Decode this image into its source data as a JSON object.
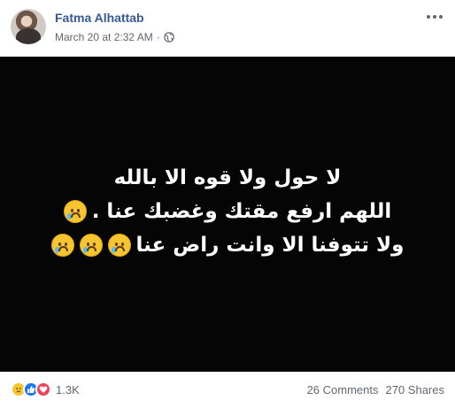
{
  "post": {
    "author": "Fatma Alhattab",
    "timestamp": "March 20 at 2:32 AM",
    "separator": "·",
    "privacy_icon": "globe-icon",
    "menu_icon": "more-horizontal-icon"
  },
  "image": {
    "lines": [
      "لا حول ولا قوه الا بالله",
      "اللهم ارفع مقتك وغضبك عنا .",
      "ولا تتوفنا الا وانت راض عنا"
    ],
    "line_emojis": [
      0,
      1,
      3
    ],
    "emoji": "crying-face-icon",
    "background": "#050505",
    "text_color": "#ffffff"
  },
  "footer": {
    "reactions": [
      "sad-reaction-icon",
      "like-reaction-icon",
      "love-reaction-icon"
    ],
    "reaction_count": "1.3K",
    "comments": "26 Comments",
    "shares": "270 Shares"
  }
}
